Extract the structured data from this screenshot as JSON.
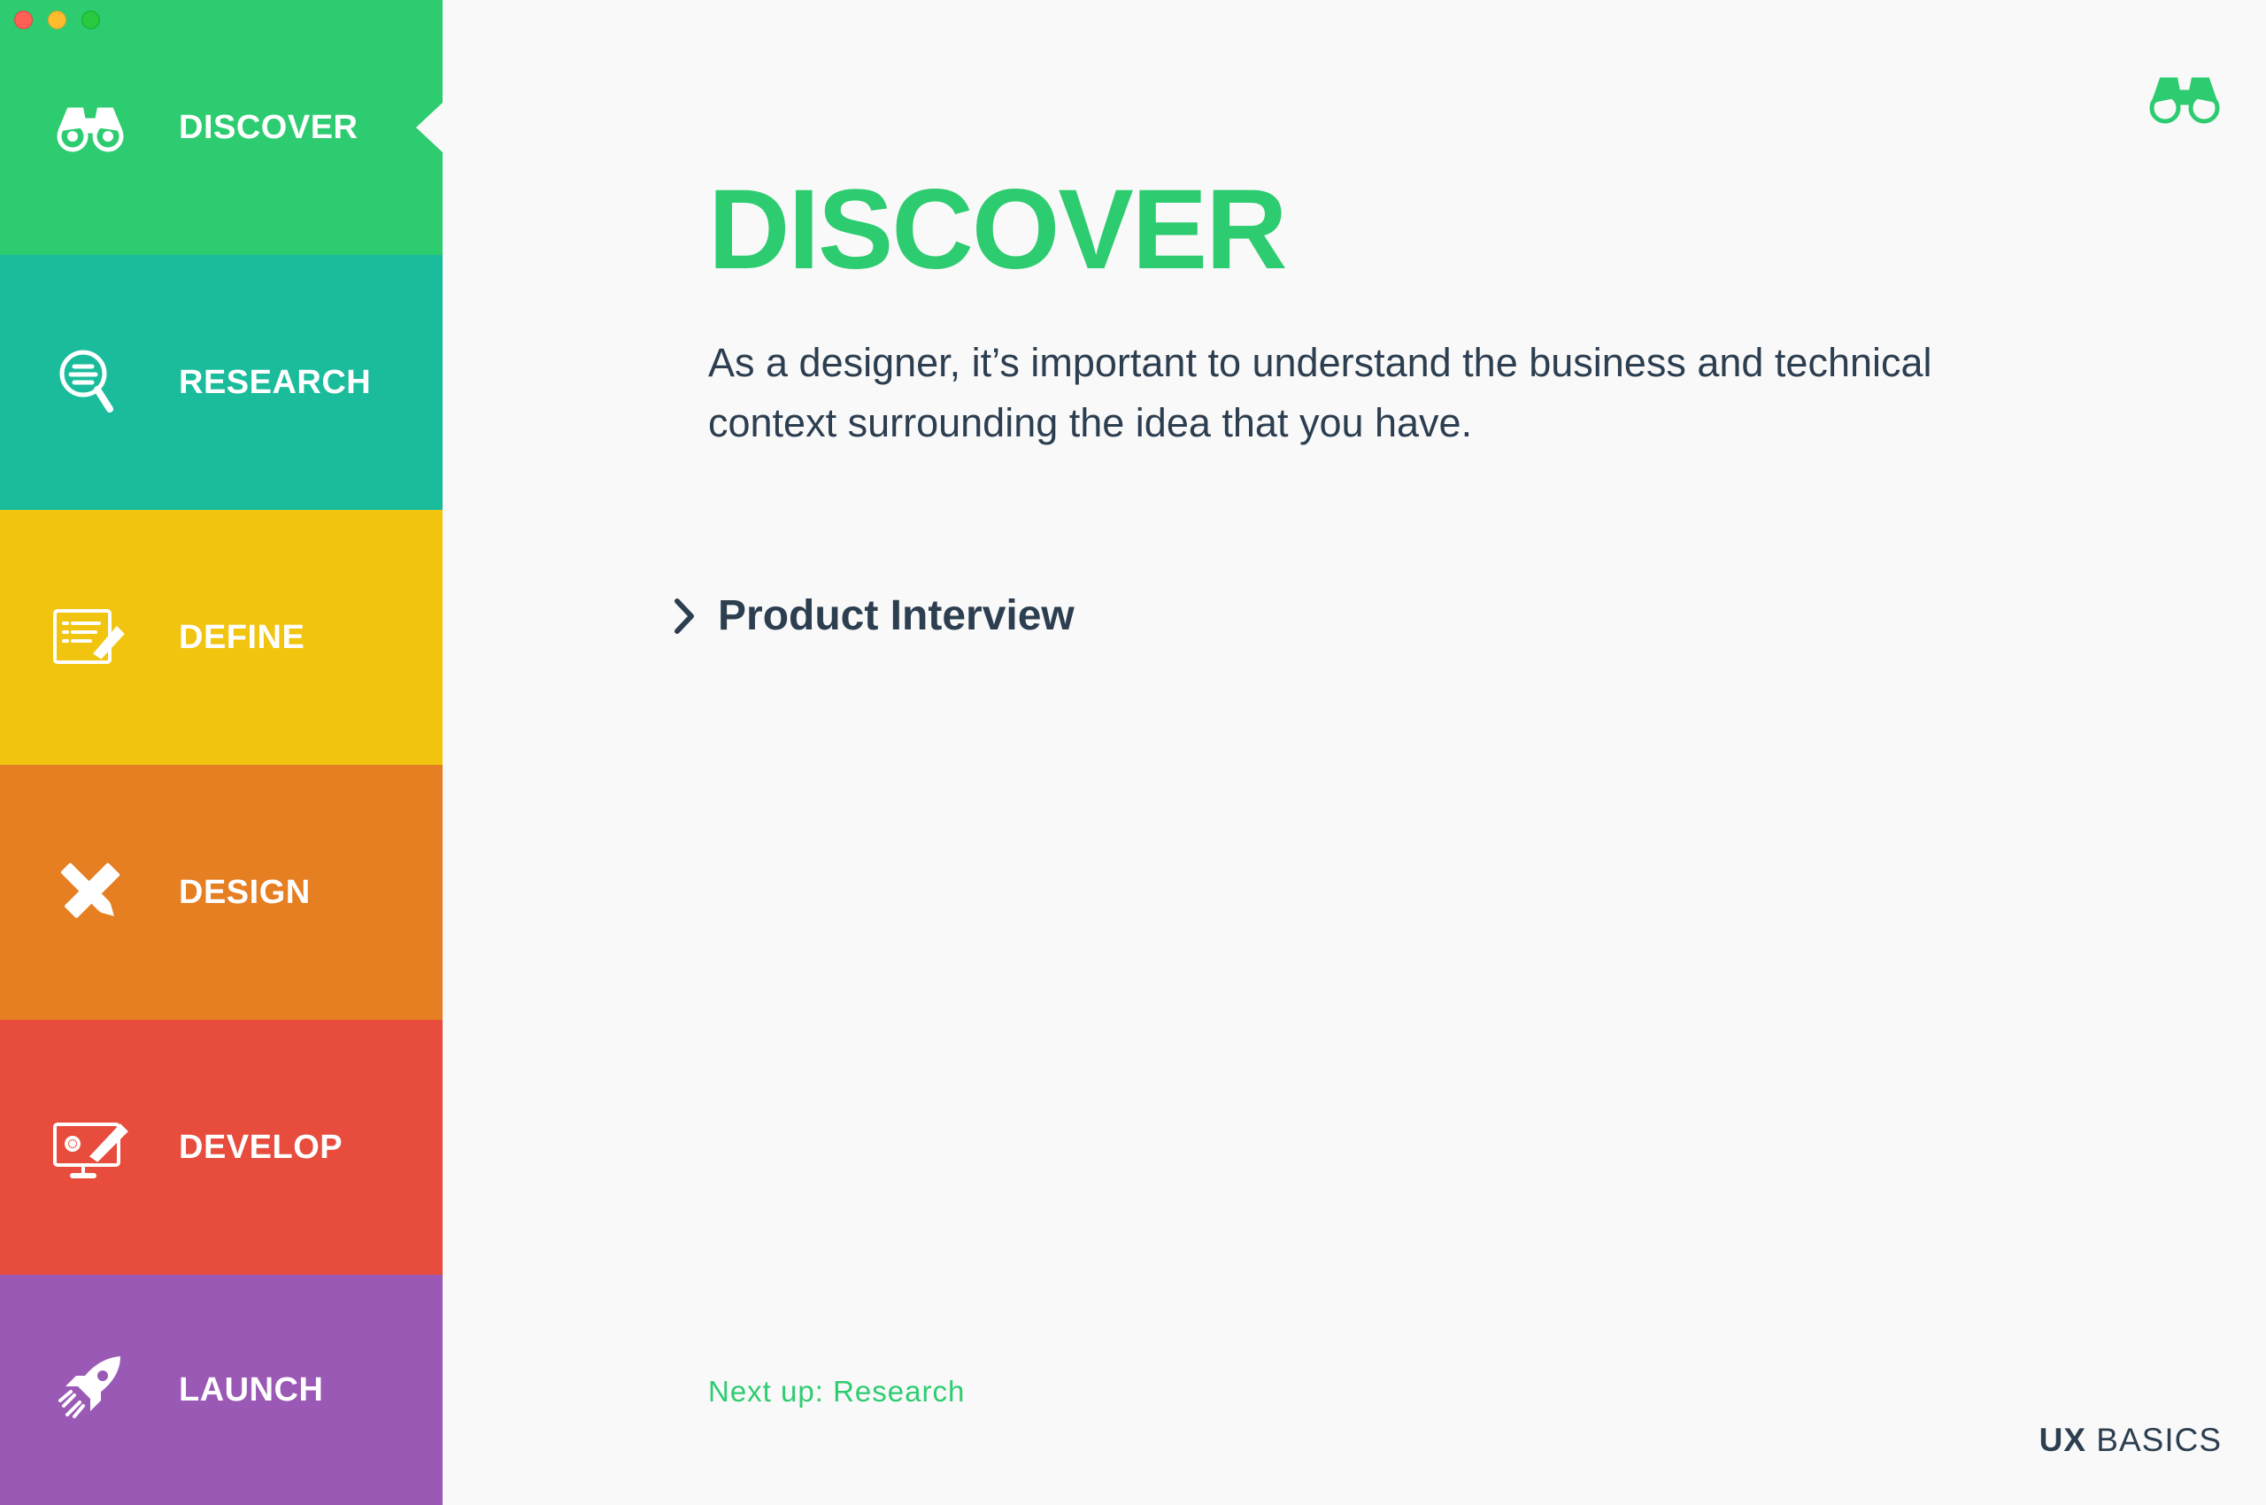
{
  "colors": {
    "accent": "#2ecc71",
    "text_dark": "#2c3e50",
    "discover": "#2ecc71",
    "research": "#1abc9c",
    "define": "#f1c40f",
    "design": "#e67e22",
    "develop": "#e74c3c",
    "launch": "#9b59b6"
  },
  "sidebar": {
    "items": [
      {
        "label": "DISCOVER",
        "icon": "binoculars-icon",
        "color": "#2ecc71",
        "active": true
      },
      {
        "label": "RESEARCH",
        "icon": "magnifier-icon",
        "color": "#1abc9c",
        "active": false
      },
      {
        "label": "DEFINE",
        "icon": "checklist-pencil-icon",
        "color": "#f1c40f",
        "active": false
      },
      {
        "label": "DESIGN",
        "icon": "ruler-pencil-icon",
        "color": "#e67e22",
        "active": false
      },
      {
        "label": "DEVELOP",
        "icon": "monitor-gear-icon",
        "color": "#e74c3c",
        "active": false
      },
      {
        "label": "LAUNCH",
        "icon": "rocket-icon",
        "color": "#9b59b6",
        "active": false
      }
    ]
  },
  "main": {
    "corner_icon": "binoculars-icon",
    "title": "DISCOVER",
    "description": "As a designer, it’s important to understand the business and technical context surrounding the idea that you have.",
    "section_link": {
      "label": "Product Interview",
      "icon": "chevron-right-icon"
    },
    "next_up": "Next up: Research"
  },
  "brand": {
    "part1": "UX",
    "part2": "BASICS"
  }
}
